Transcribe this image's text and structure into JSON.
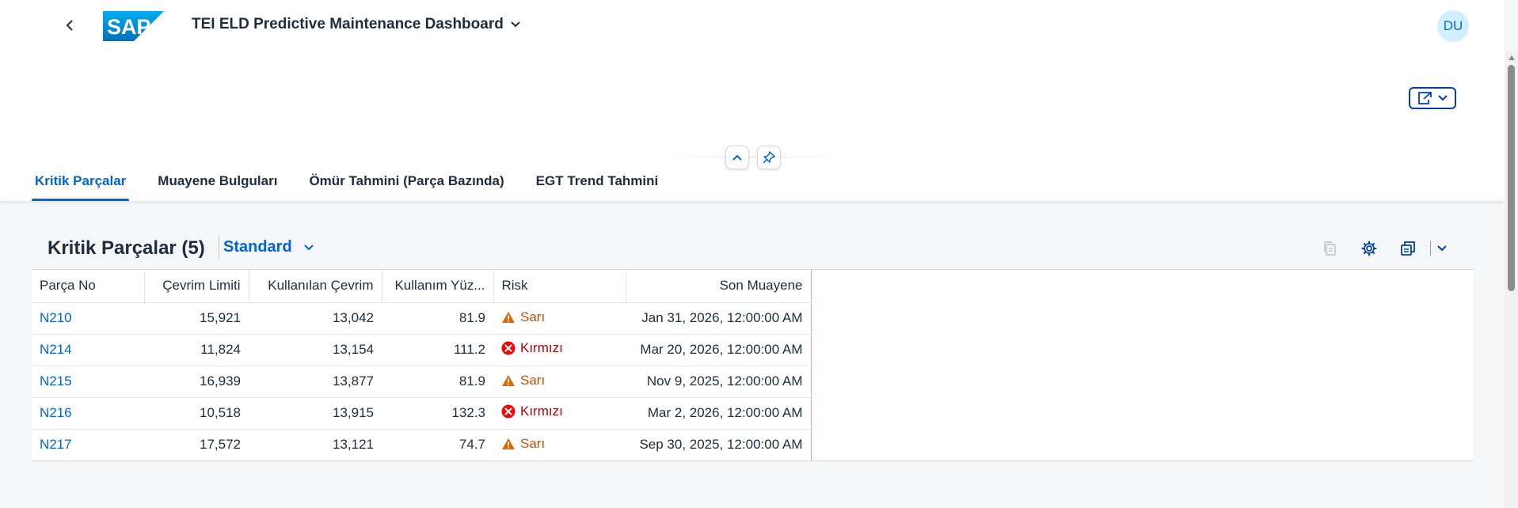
{
  "shell": {
    "logo_text": "SAP",
    "app_title": "TEI ELD Predictive Maintenance Dashboard",
    "avatar_initials": "DU"
  },
  "tabs": [
    {
      "label": "Kritik Parçalar",
      "active": true
    },
    {
      "label": "Muayene Bulguları",
      "active": false
    },
    {
      "label": "Ömür Tahmini (Parça Bazında)",
      "active": false
    },
    {
      "label": "EGT Trend Tahmini",
      "active": false
    }
  ],
  "section": {
    "title": "Kritik Parçalar (5)",
    "variant": "Standard"
  },
  "table": {
    "columns": [
      "Parça No",
      "Çevrim Limiti",
      "Kullanılan Çevrim",
      "Kullanım Yüz...",
      "Risk",
      "Son Muayene"
    ],
    "rows": [
      {
        "part": "N210",
        "limit": "15,921",
        "used": "13,042",
        "usage": "81.9",
        "risk": "Sarı",
        "risk_level": "warning",
        "last": "Jan 31, 2026, 12:00:00 AM"
      },
      {
        "part": "N214",
        "limit": "11,824",
        "used": "13,154",
        "usage": "111.2",
        "risk": "Kırmızı",
        "risk_level": "error",
        "last": "Mar 20, 2026, 12:00:00 AM"
      },
      {
        "part": "N215",
        "limit": "16,939",
        "used": "13,877",
        "usage": "81.9",
        "risk": "Sarı",
        "risk_level": "warning",
        "last": "Nov 9, 2025, 12:00:00 AM"
      },
      {
        "part": "N216",
        "limit": "10,518",
        "used": "13,915",
        "usage": "132.3",
        "risk": "Kırmızı",
        "risk_level": "error",
        "last": "Mar 2, 2026, 12:00:00 AM"
      },
      {
        "part": "N217",
        "limit": "17,572",
        "used": "13,121",
        "usage": "74.7",
        "risk": "Sarı",
        "risk_level": "warning",
        "last": "Sep 30, 2025, 12:00:00 AM"
      }
    ]
  },
  "colors": {
    "accent": "#0064d9",
    "warning": "#c35500",
    "warning_icon": "#e76500",
    "error": "#aa0808",
    "error_icon": "#e90b0b"
  },
  "icons": [
    "back-icon",
    "chevron-down-icon",
    "share-icon",
    "collapse-icon",
    "pin-icon",
    "copy-icon",
    "settings-icon",
    "export-icon",
    "warning-icon",
    "error-icon"
  ]
}
